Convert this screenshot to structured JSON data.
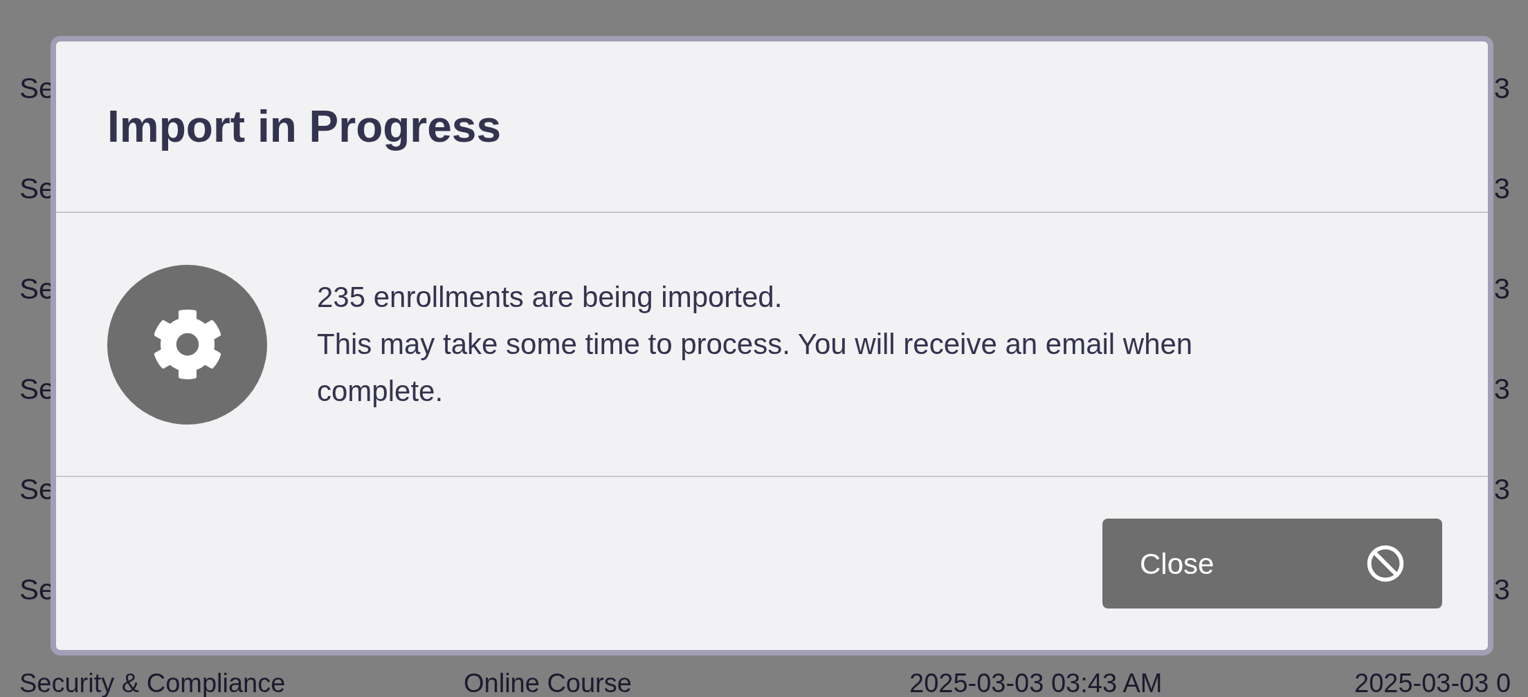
{
  "background_table": {
    "rows": [
      {
        "kind": "partial",
        "cells": [
          "Se",
          "3"
        ]
      },
      {
        "kind": "partial",
        "cells": [
          "Se",
          "3"
        ]
      },
      {
        "kind": "partial",
        "cells": [
          "Se",
          "3"
        ]
      },
      {
        "kind": "partial",
        "cells": [
          "Se",
          "3"
        ]
      },
      {
        "kind": "partial",
        "cells": [
          "Se",
          "3"
        ]
      },
      {
        "kind": "partial",
        "cells": [
          "Se",
          "3"
        ]
      },
      {
        "kind": "full",
        "cells": [
          "Security & Compliance",
          "Online Course",
          "2025-03-03 03:43 AM",
          "2025-03-03 0"
        ]
      }
    ]
  },
  "dialog": {
    "title": "Import in Progress",
    "message_lines": [
      "235 enrollments are being imported.",
      "This may take some time to process. You will receive an email when complete."
    ],
    "close_button": {
      "label": "Close"
    }
  }
}
